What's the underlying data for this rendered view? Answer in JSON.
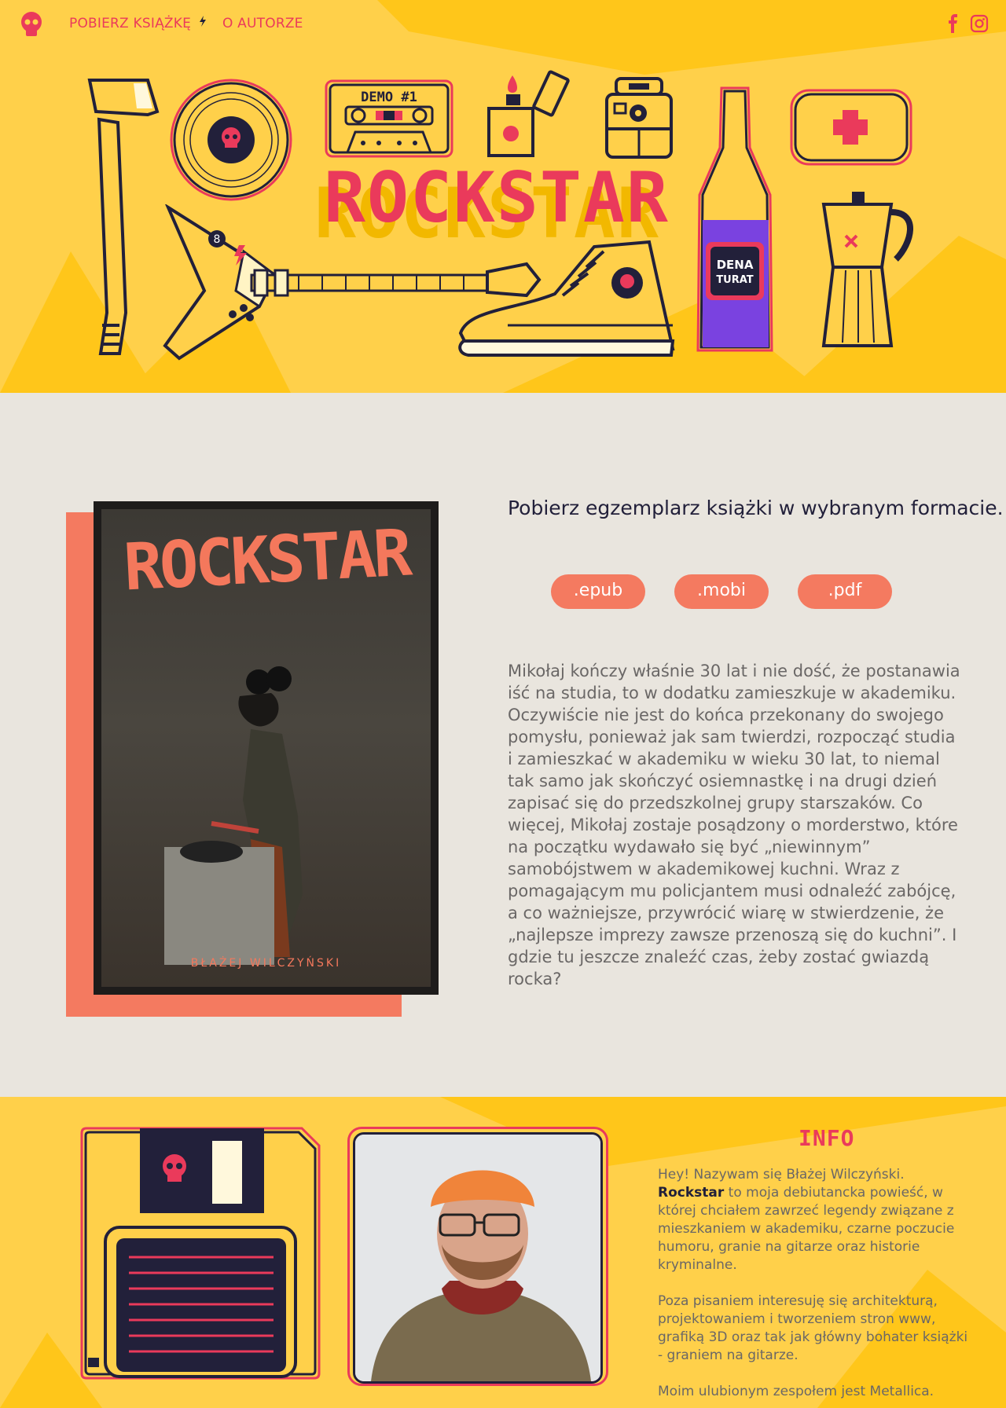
{
  "colors": {
    "yellow": "#ffd04a",
    "pink": "#ea3a5b",
    "navy": "#22203a",
    "salmon": "#f47a60",
    "cream": "#e9e5de",
    "purple": "#7a42e0"
  },
  "nav": {
    "logo_icon": "skull-icon",
    "download_label": "POBIERZ KSIĄŻKĘ",
    "download_icon": "lightning-icon",
    "author_label": "O AUTORZE",
    "facebook_icon": "facebook-icon",
    "instagram_icon": "instagram-icon"
  },
  "hero": {
    "title": "ROCKSTAR",
    "cassette_label": "DEMO #1",
    "bottle_label_line1": "DENA",
    "bottle_label_line2": "TURAT"
  },
  "book": {
    "cover_title": "ROCKSTAR",
    "cover_author": "BŁAŻEJ WILCZYŃSKI",
    "heading": "Pobierz egzemplarz książki w wybranym formacie.",
    "formats": [
      ".epub",
      ".mobi",
      ".pdf"
    ],
    "synopsis": "Mikołaj kończy właśnie 30 lat i nie dość, że postanawia iść na studia,  to w dodatku zamieszkuje w akademiku. Oczywiście nie jest do końca przekonany do swojego pomysłu, ponieważ jak sam twierdzi, rozpocząć studia i zamieszkać w akademiku w wieku 30 lat, to niemal tak samo jak skończyć osiemnastkę i na drugi dzień zapisać się do przedszkolnej grupy starszaków. Co więcej, Mikołaj zostaje posądzony o morderstwo, które na początku wydawało się być „niewinnym” samobójstwem w akademikowej kuchni. Wraz z pomagającym mu policjantem musi odnaleźć zabójcę, a co ważniejsze, przywrócić wiarę w stwierdzenie, że „najlepsze imprezy zawsze przenoszą się do kuchni”. I gdzie tu jeszcze znaleźć czas, żeby zostać gwiazdą rocka?"
  },
  "author": {
    "info_title": "INFO",
    "bio_p1_before": "Hey! Nazywam się Błażej Wilczyński. ",
    "bio_p1_bold": "Rockstar",
    "bio_p1_after": " to moja debiutancka powieść, w której chciałem zawrzeć legendy związane z mieszkaniem w akademiku, czarne poczucie humoru, granie na gitarze oraz historie kryminalne.",
    "bio_p2": "Poza pisaniem interesuję się architekturą, projektowaniem i tworzeniem stron www, grafiką 3D oraz tak jak główny bohater książki - graniem na gitarze.",
    "bio_p3": "Moim ulubionym zespołem jest Metallica."
  }
}
